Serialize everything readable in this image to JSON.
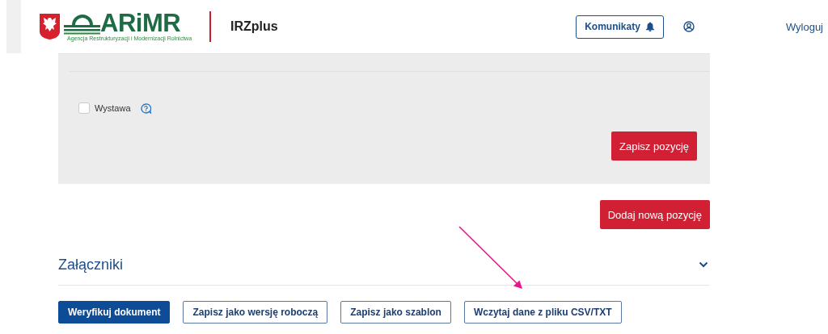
{
  "header": {
    "logo_name": "ARiMR",
    "logo_tagline": "Agencja Restrukturyzacji i Modernizacji Rolnictwa",
    "app_name": "IRZplus",
    "messages_button": "Komunikaty",
    "logout": "Wyloguj"
  },
  "position_panel": {
    "checkboxes": [
      {
        "label": "Wystawa",
        "checked": false
      }
    ],
    "save_button": "Zapisz pozycję"
  },
  "add_button": "Dodaj nową pozycję",
  "attachments": {
    "title": "Załączniki",
    "expanded": false
  },
  "actions": [
    {
      "label": "Weryfikuj dokument",
      "kind": "primary"
    },
    {
      "label": "Zapisz jako wersję roboczą",
      "kind": "secondary"
    },
    {
      "label": "Zapisz jako szablon",
      "kind": "secondary"
    },
    {
      "label": "Wczytaj dane z pliku CSV/TXT",
      "kind": "secondary"
    }
  ],
  "annotation": {
    "kind": "arrow"
  }
}
